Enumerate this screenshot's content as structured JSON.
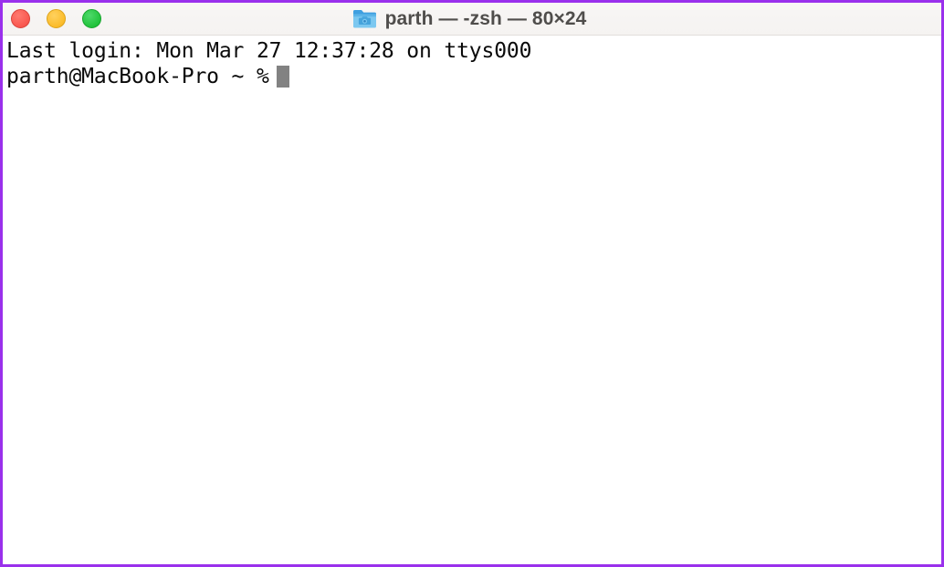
{
  "window": {
    "title": "parth — -zsh — 80×24",
    "icon": "folder-screenshots-icon",
    "border_color": "#9a30ec",
    "titlebar_color": "#f7f5f3",
    "background_color": "#ffffff"
  },
  "traffic_lights": [
    {
      "name": "close",
      "label": "Close",
      "color": "#f9584f"
    },
    {
      "name": "minimize",
      "label": "Minimize",
      "color": "#fbbc2b"
    },
    {
      "name": "maximize",
      "label": "Maximize",
      "color": "#22c33c"
    }
  ],
  "terminal": {
    "lines": [
      "Last login: Mon Mar 27 12:37:28 on ttys000"
    ],
    "prompt": "parth@MacBook-Pro ~ %",
    "input_value": "",
    "cursor_color": "#828282",
    "text_color": "#0a0a0a",
    "columns": "80",
    "rows": "24"
  }
}
